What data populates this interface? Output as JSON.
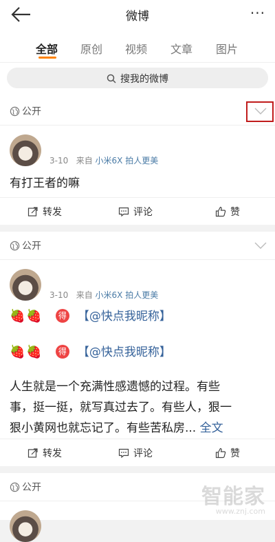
{
  "header": {
    "title": "微博",
    "more": "···"
  },
  "tabs": [
    {
      "label": "全部"
    },
    {
      "label": "原创"
    },
    {
      "label": "视频"
    },
    {
      "label": "文章"
    },
    {
      "label": "图片"
    }
  ],
  "search": {
    "placeholder": "搜我的微博"
  },
  "posts": [
    {
      "visibility": "公开",
      "date": "3-10",
      "from": "来自",
      "source": "小米6X 拍人更美",
      "text": "有打王者的嘛",
      "actions": {
        "repost": "转发",
        "comment": "评论",
        "like": "赞"
      }
    },
    {
      "visibility": "公开",
      "date": "3-10",
      "from": "来自",
      "source": "小米6X 拍人更美",
      "line1_mention": "【@快点我昵称】",
      "line2_mention": "【@快点我昵称】",
      "de": "得",
      "body1": "人生就是一个充满性感遗憾的过程。有些",
      "body2": "事，挺一挺，就写真过去了。有些人，狠一",
      "body3": "狠小黄网也就忘记了。有些苦私房...",
      "more": "全文",
      "actions": {
        "repost": "转发",
        "comment": "评论",
        "like": "赞"
      }
    },
    {
      "visibility": "公开"
    }
  ],
  "watermark": {
    "cn": "智能家",
    "url": "www.znj.com"
  }
}
